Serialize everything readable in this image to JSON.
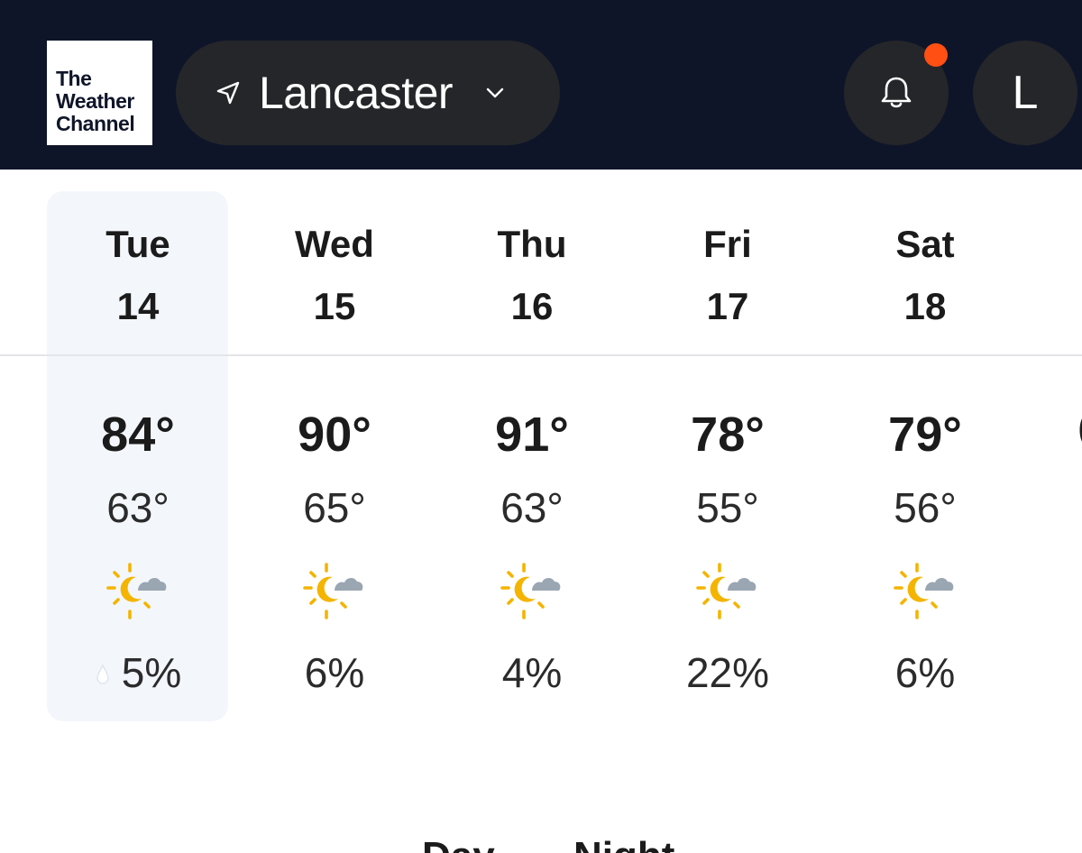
{
  "header": {
    "logo_lines": [
      "The",
      "Weather",
      "Channel"
    ],
    "location": "Lancaster",
    "location_icon": "navigation-arrow-icon",
    "dropdown_icon": "chevron-down-icon",
    "notifications_icon": "bell-icon",
    "notification_indicator": true,
    "avatar_initial": "L"
  },
  "colors": {
    "header_bg": "#0f1529",
    "pill_bg": "#252629",
    "notification_dot": "#ff4f12",
    "selected_day_bg": "#f3f7fc",
    "sun": "#f4b400",
    "cloud": "#9aa6b2"
  },
  "days": [
    {
      "day": "Tue",
      "date": "14",
      "high": "84°",
      "low": "63°",
      "icon": "partly-cloudy-night-icon",
      "precip": "5%",
      "selected": true
    },
    {
      "day": "Wed",
      "date": "15",
      "high": "90°",
      "low": "65°",
      "icon": "partly-cloudy-night-icon",
      "precip": "6%",
      "selected": false
    },
    {
      "day": "Thu",
      "date": "16",
      "high": "91°",
      "low": "63°",
      "icon": "partly-cloudy-night-icon",
      "precip": "4%",
      "selected": false
    },
    {
      "day": "Fri",
      "date": "17",
      "high": "78°",
      "low": "55°",
      "icon": "partly-cloudy-night-icon",
      "precip": "22%",
      "selected": false
    },
    {
      "day": "Sat",
      "date": "18",
      "high": "79°",
      "low": "56°",
      "icon": "partly-cloudy-night-icon",
      "precip": "6%",
      "selected": false
    }
  ],
  "tabs": [
    "Day",
    "Night"
  ]
}
